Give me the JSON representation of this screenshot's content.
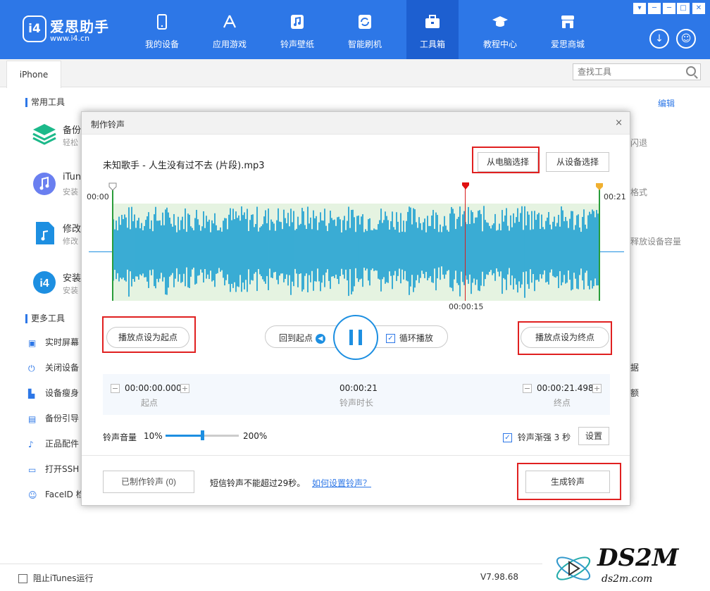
{
  "app": {
    "logo_mark": "i4",
    "name": "爱思助手",
    "url": "www.i4.cn"
  },
  "nav": [
    {
      "label": "我的设备",
      "icon": "phone-icon"
    },
    {
      "label": "应用游戏",
      "icon": "appstore-icon"
    },
    {
      "label": "铃声壁纸",
      "icon": "music-icon"
    },
    {
      "label": "智能刷机",
      "icon": "refresh-icon"
    },
    {
      "label": "工具箱",
      "icon": "toolbox-icon",
      "active": true
    },
    {
      "label": "教程中心",
      "icon": "graduation-cap-icon"
    },
    {
      "label": "爱思商城",
      "icon": "store-icon"
    }
  ],
  "window_buttons": [
    "▾",
    "─",
    "□",
    "✕"
  ],
  "tab": {
    "label": "iPhone"
  },
  "search": {
    "placeholder": "查找工具"
  },
  "sections": {
    "common": "常用工具",
    "more": "更多工具",
    "edit": "编辑"
  },
  "tools": [
    {
      "name": "备份",
      "desc": "轻松"
    },
    {
      "name": "iTun",
      "desc": "安装"
    },
    {
      "name": "修改",
      "desc": "修改"
    },
    {
      "name": "安装",
      "desc": "安装"
    }
  ],
  "right_snippets": [
    "闪退",
    "格式",
    "释放设备容量",
    "据",
    "额"
  ],
  "more_tools": [
    "实时屏幕",
    "关闭设备",
    "设备瘦身",
    "备份引导",
    "正品配件",
    "打开SSH",
    "FaceID 检"
  ],
  "bottom": {
    "block_itunes": "阻止iTunes运行",
    "version": "V7.98.68"
  },
  "watermark": {
    "big": "DS2M",
    "small": "ds2m.com"
  },
  "dialog": {
    "title": "制作铃声",
    "close": "×",
    "file": "未知歌手 - 人生没有过不去 (片段).mp3",
    "from_pc": "从电脑选择",
    "from_device": "从设备选择",
    "time_start": "00:00",
    "time_end": "00:21",
    "time_cursor": "00:00:15",
    "set_start": "播放点设为起点",
    "set_end": "播放点设为终点",
    "back_to_start": "回到起点",
    "loop": "循环播放",
    "start_value": "00:00:00.000",
    "start_label": "起点",
    "duration_value": "00:00:21",
    "duration_label": "铃声时长",
    "end_value": "00:00:21.498",
    "end_label": "终点",
    "volume_label": "铃声音量",
    "volume_min": "10%",
    "volume_max": "200%",
    "volume_fraction": 0.5,
    "fade_label": "铃声渐强 3 秒",
    "settings": "设置",
    "made_count": "已制作铃声 (0)",
    "sms_note": "短信铃声不能超过29秒。",
    "how_to": "如何设置铃声？",
    "generate": "生成铃声"
  }
}
